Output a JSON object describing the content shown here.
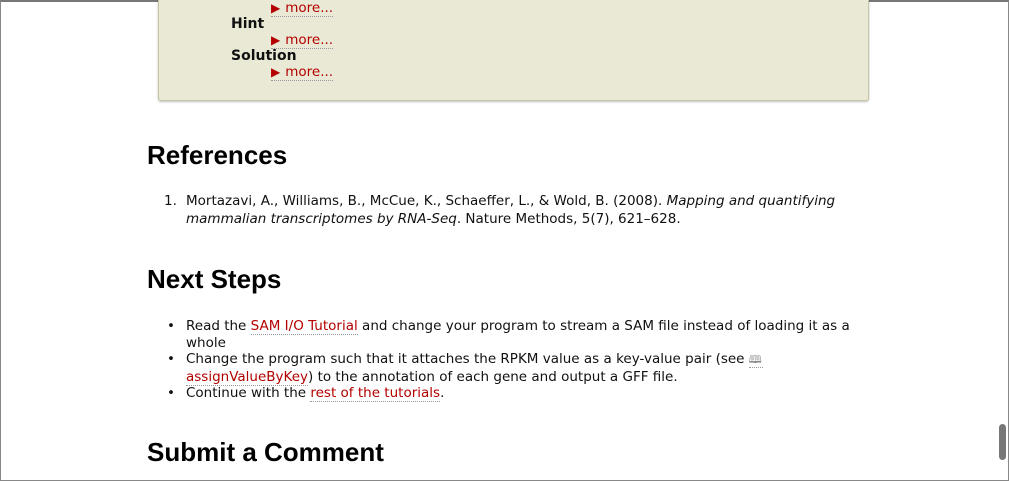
{
  "hint_box": {
    "items": [
      {
        "label": "",
        "more": "more..."
      },
      {
        "label": "Hint",
        "more": "more..."
      },
      {
        "label": "Solution",
        "more": "more..."
      }
    ]
  },
  "references": {
    "heading": "References",
    "items": [
      {
        "num": "1.",
        "authors": "Mortazavi, A., Williams, B., McCue, K., Schaeffer, L., & Wold, B. (2008).",
        "title": "Mapping and quantifying mammalian transcriptomes by RNA-Seq",
        "journal": ". Nature Methods, 5(7), 621–628."
      }
    ]
  },
  "next_steps": {
    "heading": "Next Steps",
    "items": [
      {
        "pre": "Read the ",
        "link": "SAM I/O Tutorial",
        "post": " and change your program to stream a SAM file instead of loading it as a whole"
      },
      {
        "pre": "Change the program such that it attaches the RPKM value as a key-value pair (see ",
        "link": "assignValueByKey",
        "post": ") to the annotation of each gene and output a GFF file."
      },
      {
        "pre": "Continue with the ",
        "link": "rest of the tutorials",
        "post": "."
      }
    ]
  },
  "comment": {
    "heading": "Submit a Comment"
  },
  "icons": {
    "more": "triangle-right-icon",
    "doc": "book-icon"
  },
  "colors": {
    "link": "#b30000",
    "box": "#e9e9d5"
  }
}
